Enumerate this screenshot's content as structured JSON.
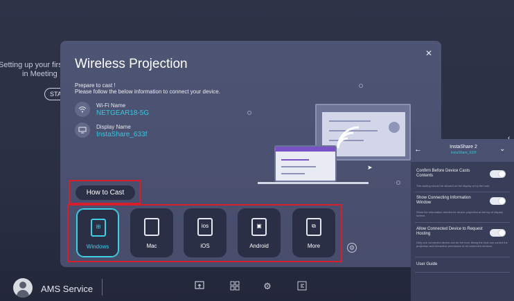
{
  "background": {
    "line1": "Setting up your firs",
    "line2": "in Meeting",
    "start_button": "STA"
  },
  "bottom_bar": {
    "user_name": "AMS Service",
    "dock_icons": [
      "cast-icon",
      "grid-icon",
      "settings-icon",
      "exit-icon"
    ]
  },
  "dialog": {
    "title": "Wireless Projection",
    "prepare_line1": "Prepare to cast !",
    "prepare_line2": "Please follow the below information to connect your device.",
    "wifi_label": "Wi-Fi Name",
    "wifi_value": "NETGEAR18-5G",
    "display_label": "Display Name",
    "display_value": "InstaShare_633f",
    "how_to_cast": "How to Cast",
    "tiles": [
      {
        "label": "Windows",
        "icon_text": "⊞",
        "active": true
      },
      {
        "label": "Mac",
        "icon_text": "",
        "active": false
      },
      {
        "label": "iOS",
        "icon_text": "ios",
        "active": false
      },
      {
        "label": "Android",
        "icon_text": "▣",
        "active": false
      },
      {
        "label": "More",
        "icon_text": "⧉",
        "active": false
      }
    ],
    "accent_color": "#35c7df"
  },
  "panel": {
    "title": "InstaShare 2",
    "subtitle": "InstaShare_633f",
    "settings": [
      {
        "label": "Confirm Before Device Casts Contents",
        "desc": "The casting should be allowed on the display or by the host."
      },
      {
        "label": "Show Connecting Information Window",
        "desc": "Show the information needed for device projection at the top of display screen."
      },
      {
        "label": "Allow Connected Device to Request Hosting",
        "desc": "Only one connected device can be the host. Being the host can control the projection and interactive permission of all connected devices."
      }
    ],
    "user_guide": "User Guide"
  }
}
